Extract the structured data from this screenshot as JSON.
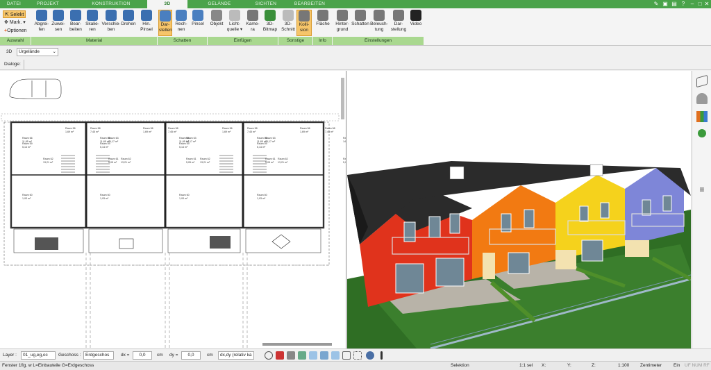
{
  "tabs": [
    "DATEI",
    "PROJEKT",
    "KONSTRUKTION",
    "3D",
    "GELÄNDE",
    "SICHTEN",
    "BEARBEITEN"
  ],
  "active_tab": "3D",
  "ribbon": {
    "auswahl": {
      "selekt": "Selekt",
      "mark": "Mark.",
      "optionen": "Optionen",
      "group": "Auswahl"
    },
    "material": {
      "buttons": [
        {
          "l1": "Abgrei-",
          "l2": "fen"
        },
        {
          "l1": "Zuwei-",
          "l2": "sen"
        },
        {
          "l1": "Bear-",
          "l2": "beiten"
        },
        {
          "l1": "Skalie-",
          "l2": "ren"
        },
        {
          "l1": "Verschie-",
          "l2": "ben"
        },
        {
          "l1": "Drehen",
          "l2": ""
        },
        {
          "l1": "Hin.",
          "l2": "Pinsel"
        }
      ],
      "group": "Material"
    },
    "schatten": {
      "buttons": [
        {
          "l1": "Dar-",
          "l2": "stellen"
        },
        {
          "l1": "Rech-",
          "l2": "nen"
        },
        {
          "l1": "Pinsel",
          "l2": ""
        }
      ],
      "group": "Schatten"
    },
    "einfuegen": {
      "buttons": [
        {
          "l1": "Objekt",
          "l2": ""
        },
        {
          "l1": "Licht-",
          "l2": "quelle ▾"
        },
        {
          "l1": "Kame-",
          "l2": "ra"
        },
        {
          "l1": "3D-",
          "l2": "Bitmap"
        }
      ],
      "group": "Einfügen"
    },
    "sonstige": {
      "buttons": [
        {
          "l1": "3D-",
          "l2": "Schnitt"
        },
        {
          "l1": "Kolli-",
          "l2": "sion"
        }
      ],
      "group": "Sonstige"
    },
    "info": {
      "buttons": [
        {
          "l1": "Fläche",
          "l2": ""
        }
      ],
      "group": "Info"
    },
    "einstellungen": {
      "buttons": [
        {
          "l1": "Hinter-",
          "l2": "grund"
        },
        {
          "l1": "Schatten",
          "l2": ""
        },
        {
          "l1": "Beleuch-",
          "l2": "tung"
        },
        {
          "l1": "Dar-",
          "l2": "stellung"
        },
        {
          "l1": "Video",
          "l2": ""
        }
      ],
      "group": "Einstellungen"
    }
  },
  "toolrow": {
    "mode": "3D",
    "terrain": "Urgelände"
  },
  "dialoge_label": "Dialoge:",
  "rooms": [
    {
      "name": "Raum 56",
      "area": "1,69 m²"
    },
    {
      "name": "Raum 58",
      "area": "7,45 m²"
    },
    {
      "name": "Raum 66",
      "area": "11,85 m²"
    },
    {
      "name": "Raum 59",
      "area": "5,14 m²"
    },
    {
      "name": "Raum 63",
      "area": "14,17 m²"
    },
    {
      "name": "Raum 62",
      "area": "13,21 m²"
    },
    {
      "name": "Raum 61",
      "area": "5,05 m²"
    },
    {
      "name": "Raum 60",
      "area": "1,93 m²"
    }
  ],
  "bottom": {
    "layer_label": "Layer :",
    "layer_value": "01_ug,eg,oc",
    "geschoss_label": "Geschoss :",
    "geschoss_value": "Erdgeschos",
    "dx_label": "dx =",
    "dx_value": "0,0",
    "dy_label": "dy =",
    "dy_value": "0,0",
    "unit": "cm",
    "mode_value": "dx,dy (relativ ka"
  },
  "status": {
    "left": "Fenster 1flg. w L=Einbauteile G=Erdgeschoss",
    "selektion": "Selektion",
    "scale1": "1:1 sel",
    "x": "X:",
    "y": "Y:",
    "z": "Z:",
    "scale2": "1:100",
    "unit": "Zentimeter",
    "ein": "Ein",
    "flags": "UF NUM RF"
  },
  "colors": {
    "brand_green": "#4aa34a",
    "group_green": "#a9d88f",
    "active_orange": "#f6c56a",
    "house_red": "#e0331c",
    "house_orange": "#f27a12",
    "house_yellow": "#f5d21c",
    "house_blue": "#7e86d8",
    "roof": "#2b2b2b",
    "lawn": "#2f6e24"
  }
}
